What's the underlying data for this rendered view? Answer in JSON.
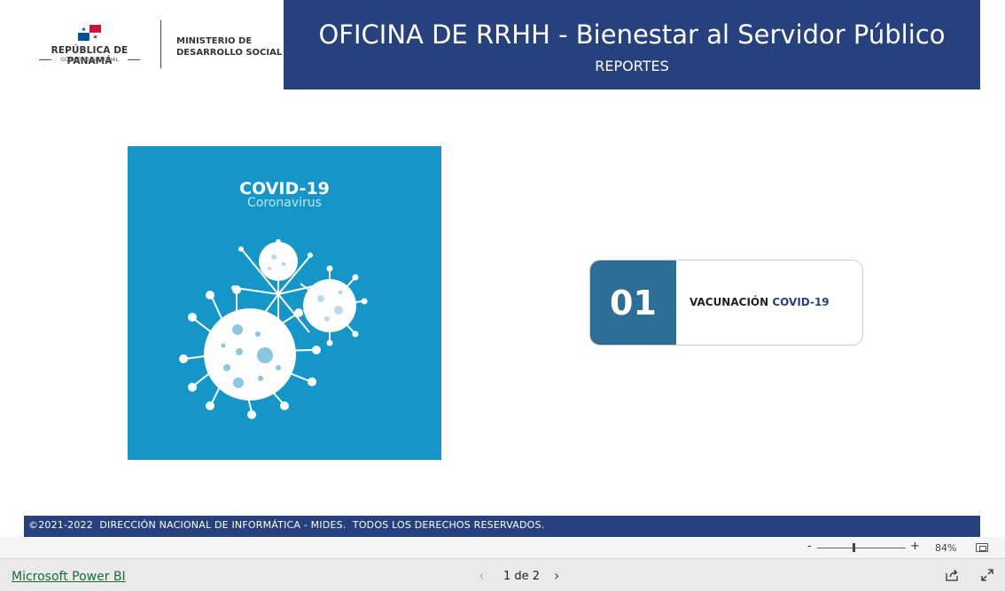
{
  "logo": {
    "republic": "REPÚBLICA DE PANAMÁ",
    "government": "GOBIERNO NACIONAL",
    "ministry_line1": "MINISTERIO DE",
    "ministry_line2": "DESARROLLO SOCIAL"
  },
  "header": {
    "title": "OFICINA DE RRHH - Bienestar al Servidor Público",
    "subtitle": "REPORTES"
  },
  "covid_image": {
    "title": "COVID-19",
    "subtitle": "Coronavirus"
  },
  "report_card": {
    "number": "01",
    "label_prefix": "VACUNACIÓN",
    "label_accent": "COVID-19"
  },
  "footer": {
    "text": "©2021-2022  DIRECCIÓN NACIONAL DE INFORMÁTICA - MIDES.  TODOS LOS DERECHOS RESERVADOS."
  },
  "zoom": {
    "minus": "-",
    "plus": "+",
    "percent": "84%"
  },
  "bottom_bar": {
    "brand_link": "Microsoft Power BI",
    "page_indicator": "1 de 2",
    "prev": "‹",
    "next": "›"
  },
  "colors": {
    "brand_navy": "#27407e",
    "covid_blue": "#1496c8",
    "card_blue": "#2c6e95"
  }
}
